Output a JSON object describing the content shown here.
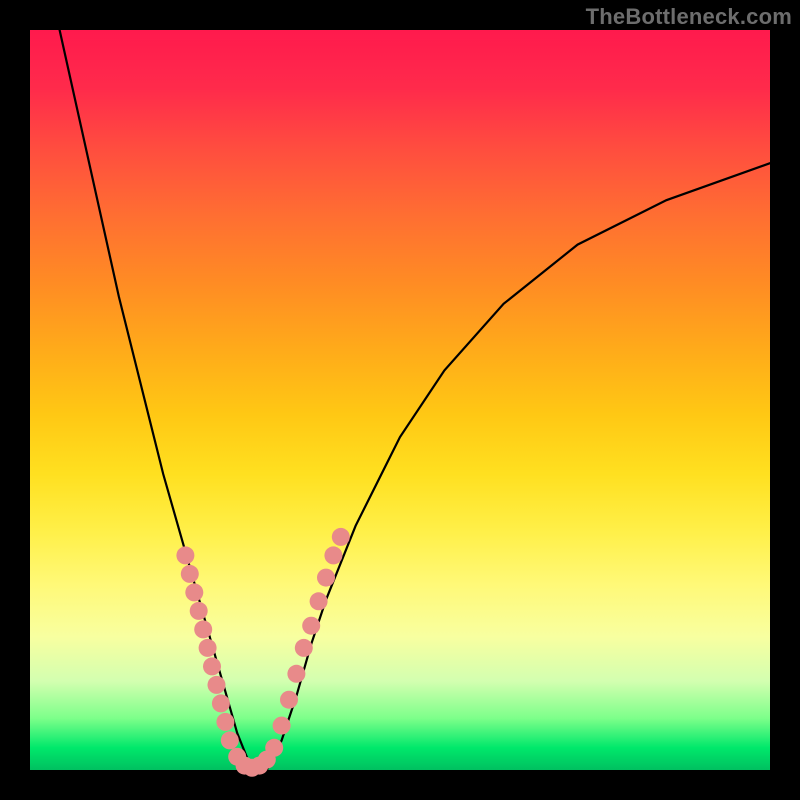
{
  "watermark": "TheBottleneck.com",
  "chart_data": {
    "type": "line",
    "title": "",
    "xlabel": "",
    "ylabel": "",
    "xlim": [
      0,
      100
    ],
    "ylim": [
      0,
      100
    ],
    "note": "V-shaped bottleneck curve over rainbow gradient; x/y are normalized 0–100, curve hits y=0 near x≈28–32.",
    "series": [
      {
        "name": "bottleneck-curve",
        "x": [
          4,
          8,
          12,
          16,
          18,
          20,
          22,
          24,
          26,
          28,
          30,
          32,
          34,
          36,
          38,
          40,
          44,
          50,
          56,
          64,
          74,
          86,
          100
        ],
        "y": [
          100,
          82,
          64,
          48,
          40,
          33,
          26,
          19,
          12,
          5,
          0,
          0,
          4,
          10,
          17,
          23,
          33,
          45,
          54,
          63,
          71,
          77,
          82
        ]
      }
    ],
    "markers": {
      "name": "highlighted-points",
      "color": "#e88a8a",
      "size": 9,
      "points": [
        {
          "x": 21.0,
          "y": 29.0
        },
        {
          "x": 21.6,
          "y": 26.5
        },
        {
          "x": 22.2,
          "y": 24.0
        },
        {
          "x": 22.8,
          "y": 21.5
        },
        {
          "x": 23.4,
          "y": 19.0
        },
        {
          "x": 24.0,
          "y": 16.5
        },
        {
          "x": 24.6,
          "y": 14.0
        },
        {
          "x": 25.2,
          "y": 11.5
        },
        {
          "x": 25.8,
          "y": 9.0
        },
        {
          "x": 26.4,
          "y": 6.5
        },
        {
          "x": 27.0,
          "y": 4.0
        },
        {
          "x": 28.0,
          "y": 1.8
        },
        {
          "x": 29.0,
          "y": 0.6
        },
        {
          "x": 30.0,
          "y": 0.3
        },
        {
          "x": 31.0,
          "y": 0.6
        },
        {
          "x": 32.0,
          "y": 1.4
        },
        {
          "x": 33.0,
          "y": 3.0
        },
        {
          "x": 34.0,
          "y": 6.0
        },
        {
          "x": 35.0,
          "y": 9.5
        },
        {
          "x": 36.0,
          "y": 13.0
        },
        {
          "x": 37.0,
          "y": 16.5
        },
        {
          "x": 38.0,
          "y": 19.5
        },
        {
          "x": 39.0,
          "y": 22.8
        },
        {
          "x": 40.0,
          "y": 26.0
        },
        {
          "x": 41.0,
          "y": 29.0
        },
        {
          "x": 42.0,
          "y": 31.5
        }
      ]
    }
  }
}
